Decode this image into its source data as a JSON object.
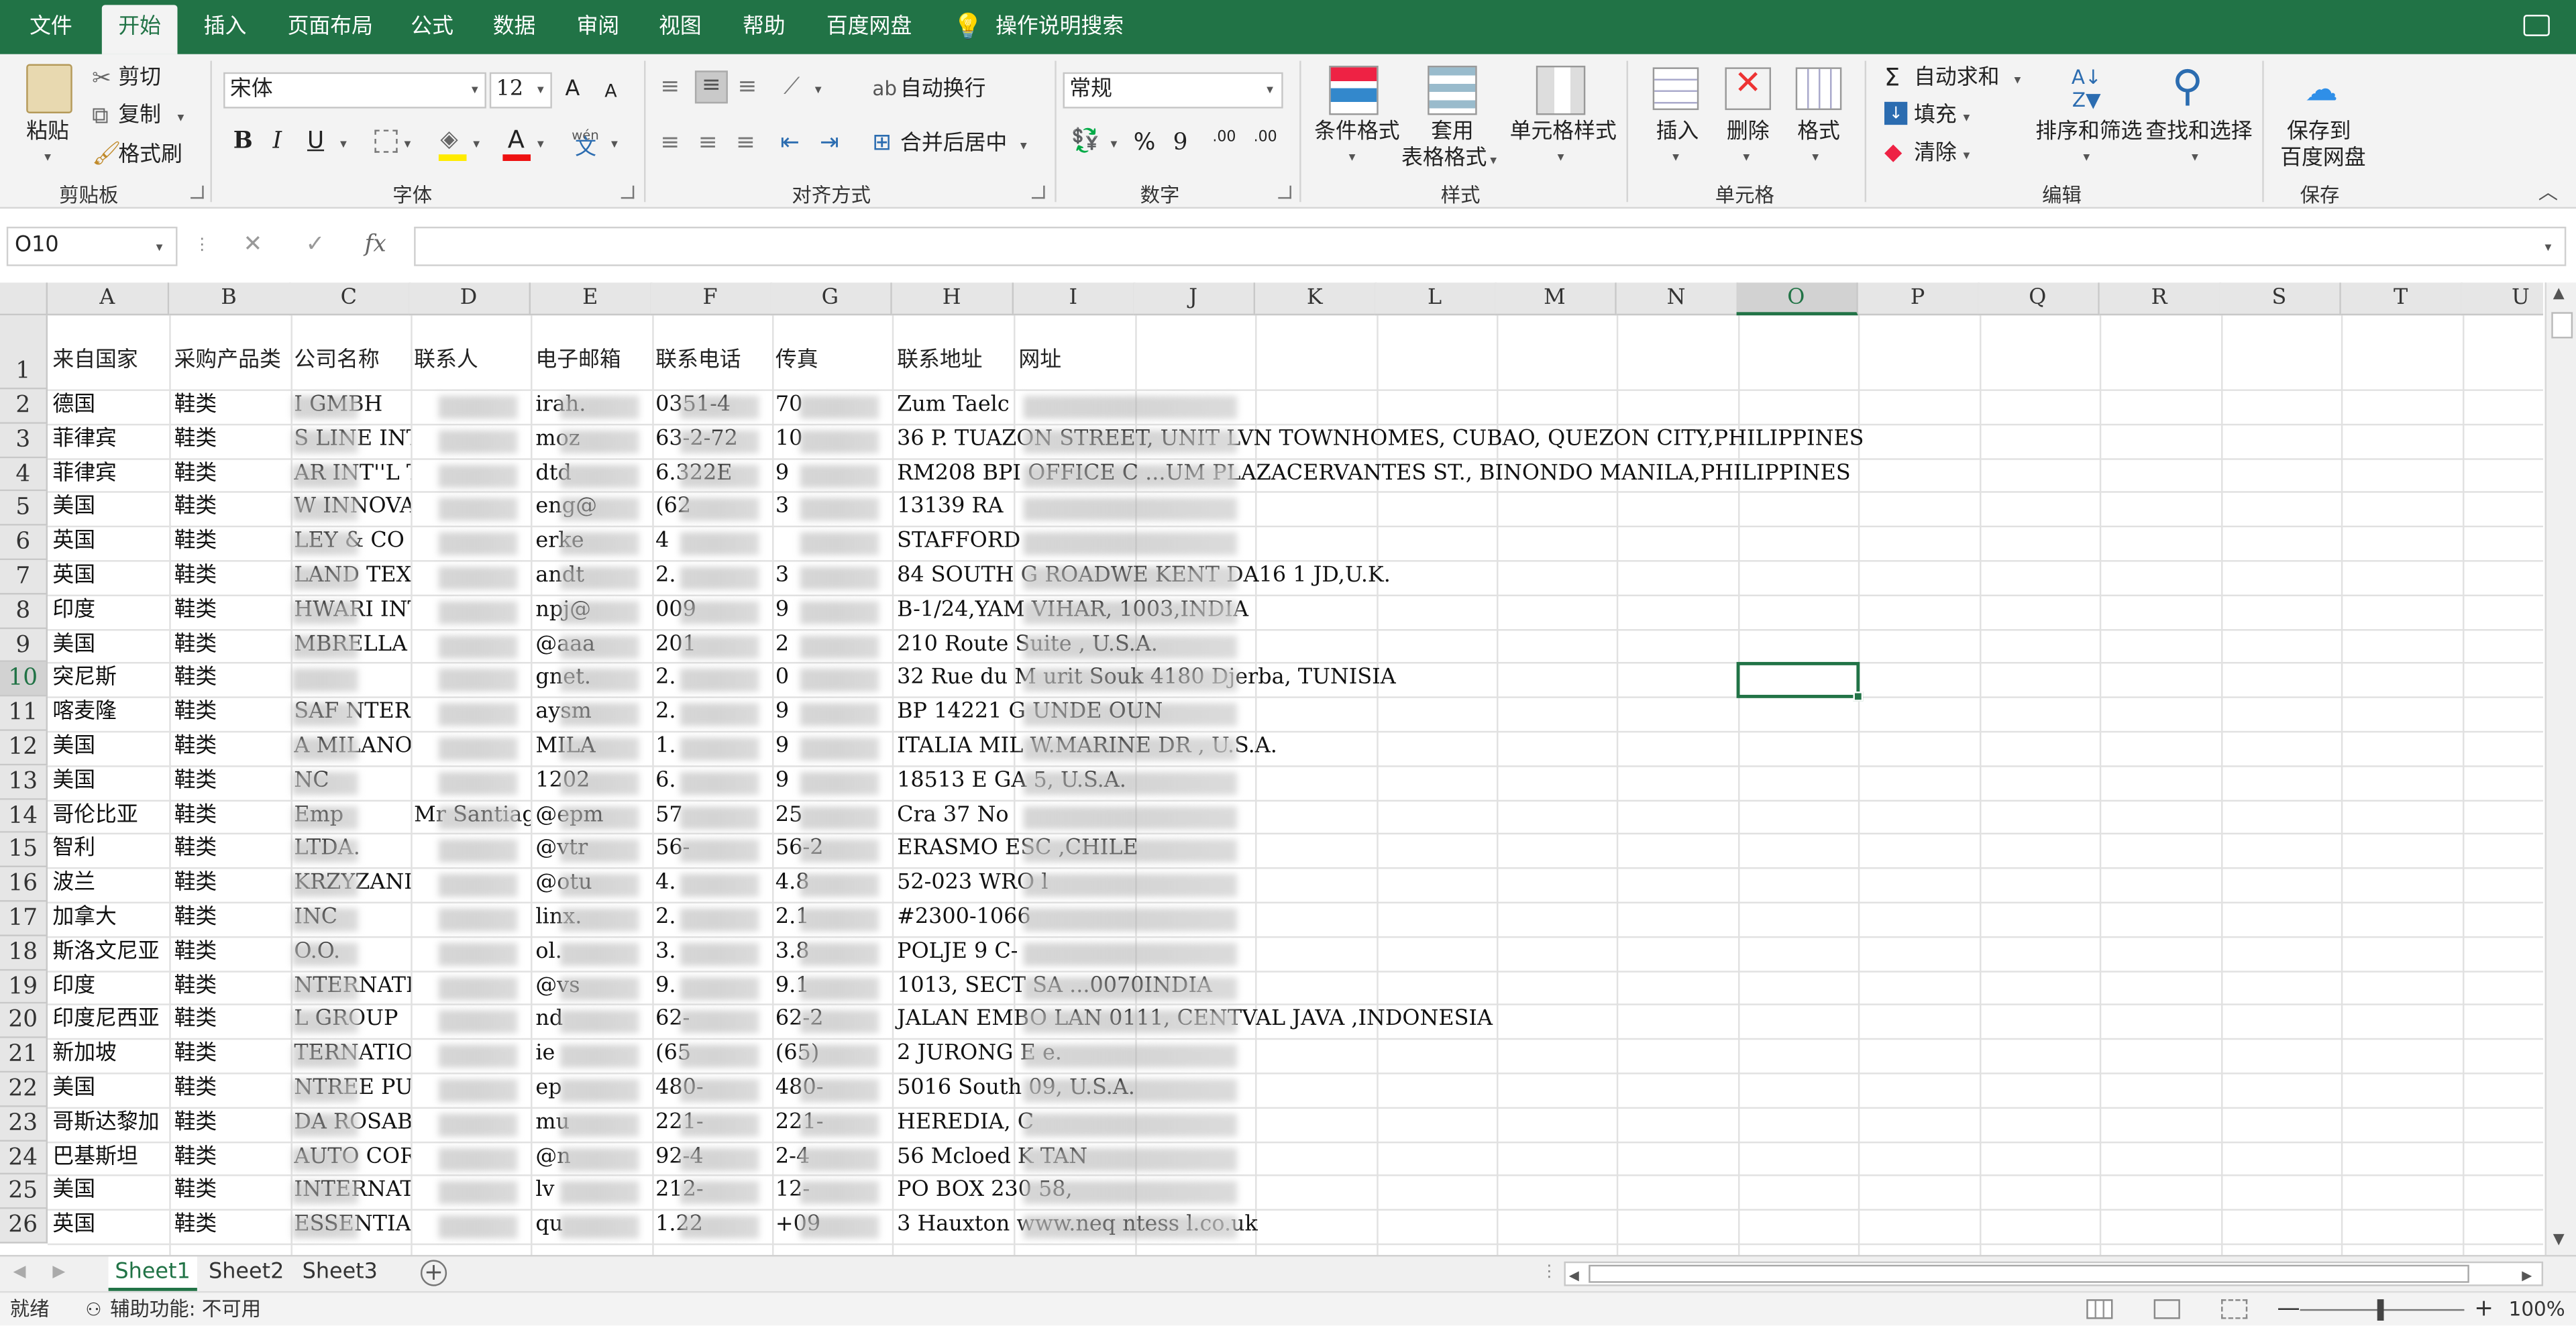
{
  "menu": {
    "file": "文件",
    "home": "开始",
    "insert": "插入",
    "page_layout": "页面布局",
    "formulas": "公式",
    "data": "数据",
    "review": "审阅",
    "view": "视图",
    "help": "帮助",
    "baidu": "百度网盘",
    "tell_me": "操作说明搜索"
  },
  "ribbon": {
    "clipboard": {
      "paste": "粘贴",
      "cut": "剪切",
      "copy": "复制",
      "format_painter": "格式刷",
      "label": "剪贴板"
    },
    "font": {
      "name": "宋体",
      "size": "12",
      "bold": "B",
      "italic": "I",
      "underline": "U",
      "phonetic": "wén",
      "phonetic_char": "文",
      "grow": "A",
      "shrink": "A",
      "font_color": "A",
      "label": "字体"
    },
    "alignment": {
      "wrap": "自动换行",
      "merge": "合并后居中",
      "label": "对齐方式"
    },
    "number": {
      "format": "常规",
      "percent": "%",
      "comma": "9",
      "inc_decimal": ".00",
      "dec_decimal": ".00",
      "label": "数字"
    },
    "styles": {
      "conditional": "条件格式",
      "table_line1": "套用",
      "table_line2": "表格格式",
      "cell_styles": "单元格样式",
      "label": "样式"
    },
    "cells": {
      "insert": "插入",
      "delete": "删除",
      "format": "格式",
      "label": "单元格"
    },
    "editing": {
      "autosum": "自动求和",
      "fill": "填充",
      "clear": "清除",
      "sort_filter": "排序和筛选",
      "find_select": "查找和选择",
      "label": "编辑"
    },
    "save": {
      "line1": "保存到",
      "line2": "百度网盘",
      "label": "保存"
    }
  },
  "formula_bar": {
    "name_box": "O10",
    "cancel": "✕",
    "enter": "✓",
    "fx": "fx",
    "value": ""
  },
  "columns": [
    "A",
    "B",
    "C",
    "D",
    "E",
    "F",
    "G",
    "H",
    "I",
    "J",
    "K",
    "L",
    "M",
    "N",
    "O",
    "P",
    "Q",
    "R",
    "S",
    "T",
    "U"
  ],
  "selected_column": "O",
  "selected_row": "10",
  "headers": {
    "A": "来自国家",
    "B": "采购产品类",
    "C": "公司名称",
    "D": "联系人",
    "E": "电子邮箱",
    "F": "联系电话",
    "G": "传真",
    "H": "联系地址",
    "I": "网址"
  },
  "rows": [
    {
      "n": "2",
      "a": "德国",
      "b": "鞋类",
      "c": "I GMBH",
      "d": "",
      "e": "irah.",
      "f": "0351-4",
      "g": "70",
      "h": "Zum Taelc"
    },
    {
      "n": "3",
      "a": "菲律宾",
      "b": "鞋类",
      "c": "S LINE INTERNATI",
      "d": "",
      "e": "moz",
      "f": "63-2-72",
      "g": "10",
      "h": "36 P. TUAZON STREET, UNIT LVN TOWNHOMES, CUBAO, QUEZON CITY,PHILIPPINES"
    },
    {
      "n": "4",
      "a": "菲律宾",
      "b": "鞋类",
      "c": "AR INT''L TRADIN",
      "d": "",
      "e": "dtd",
      "f": "6.322E",
      "g": "9",
      "h": "RM208 BPI OFFICE C ...UM PLAZACERVANTES ST., BINONDO MANILA,PHILIPPINES"
    },
    {
      "n": "5",
      "a": "美国",
      "b": "鞋类",
      "c": "W INNOVATIVE PRO",
      "d": "",
      "e": "eng@",
      "f": "(62",
      "g": "3",
      "h": "13139 RA"
    },
    {
      "n": "6",
      "a": "英国",
      "b": "鞋类",
      "c": "LEY & CO LIMITED",
      "d": "",
      "e": "erke",
      "f": "4",
      "g": "",
      "h": "STAFFORD"
    },
    {
      "n": "7",
      "a": "英国",
      "b": "鞋类",
      "c": "LAND TEXTILE",
      "d": "",
      "e": "andt",
      "f": "2.",
      "g": "3",
      "h": "84 SOUTH G ROADWE KENT DA16 1 JD,U.K."
    },
    {
      "n": "8",
      "a": "印度",
      "b": "鞋类",
      "c": "HWARI INTERNATIO",
      "d": "",
      "e": "npj@",
      "f": "009",
      "g": "9",
      "h": "B-1/24,YAM VIHAR, 1003,INDIA"
    },
    {
      "n": "9",
      "a": "美国",
      "b": "鞋类",
      "c": "MBRELLA COMPANY",
      "d": "",
      "e": "@aaa",
      "f": "201",
      "g": "2",
      "h": "210 Route Suite , U.S.A."
    },
    {
      "n": "10",
      "a": "突尼斯",
      "b": "鞋类",
      "c": "",
      "d": "",
      "e": "gnet.",
      "f": "2.",
      "g": "0",
      "h": "32 Rue du M urit Souk 4180 Djerba, TUNISIA"
    },
    {
      "n": "11",
      "a": "喀麦隆",
      "b": "鞋类",
      "c": "SAF NTERNATIONL",
      "d": "",
      "e": "aysm",
      "f": "2.",
      "g": "9",
      "h": "BP 14221 G UNDE OUN"
    },
    {
      "n": "12",
      "a": "美国",
      "b": "鞋类",
      "c": "A MILANO GUAM",
      "d": "",
      "e": "MILA",
      "f": "1.",
      "g": "9",
      "h": "ITALIA MIL W.MARINE DR , U.S.A."
    },
    {
      "n": "13",
      "a": "美国",
      "b": "鞋类",
      "c": "NC",
      "d": "",
      "e": "1202",
      "f": "6.",
      "g": "9",
      "h": "18513 E GA 5, U.S.A."
    },
    {
      "n": "14",
      "a": "哥伦比亚",
      "b": "鞋类",
      "c": "Emp",
      "d": "Mr Santiago",
      "e": "@epm",
      "f": "57",
      "g": "25",
      "h": "Cra 37 No"
    },
    {
      "n": "15",
      "a": "智利",
      "b": "鞋类",
      "c": "LTDA.",
      "d": "",
      "e": "@vtr",
      "f": "56-",
      "g": "56-2",
      "h": "ERASMO ESC ,CHILE"
    },
    {
      "n": "16",
      "a": "波兰",
      "b": "鞋类",
      "c": "KRZYZANIAK ROB",
      "d": "",
      "e": "@otu",
      "f": "4.",
      "g": "4.8",
      "h": "52-023 WRO l"
    },
    {
      "n": "17",
      "a": "加拿大",
      "b": "鞋类",
      "c": "INC",
      "d": "",
      "e": "linx.",
      "f": "2.",
      "g": "2.1",
      "h": "#2300-1066"
    },
    {
      "n": "18",
      "a": "斯洛文尼亚",
      "b": "鞋类",
      "c": "O.O.",
      "d": "",
      "e": "ol.",
      "f": "3.",
      "g": "3.8",
      "h": "POLJE 9 C-"
    },
    {
      "n": "19",
      "a": "印度",
      "b": "鞋类",
      "c": "NTERNATIONAL",
      "d": "",
      "e": "@vs",
      "f": "9.",
      "g": "9.1",
      "h": "1013, SECT SA ...0070INDIA"
    },
    {
      "n": "20",
      "a": "印度尼西亚",
      "b": "鞋类",
      "c": "L GROUP",
      "d": "",
      "e": "nd",
      "f": "62-",
      "g": "62-2",
      "h": "JALAN EMBO LAN 0111, CENTVAL JAVA ,INDONESIA"
    },
    {
      "n": "21",
      "a": "新加坡",
      "b": "鞋类",
      "c": "TERNATIONAL GROU",
      "d": "",
      "e": "ie",
      "f": "(65",
      "g": "(65)",
      "h": "2 JURONG E e."
    },
    {
      "n": "22",
      "a": "美国",
      "b": "鞋类",
      "c": "NTREE PUBLISHING",
      "d": "",
      "e": "ep",
      "f": "480-",
      "g": "480-",
      "h": "5016 South 09, U.S.A."
    },
    {
      "n": "23",
      "a": "哥斯达黎加",
      "b": "鞋类",
      "c": "DA ROSABAL",
      "d": "",
      "e": "mu",
      "f": "221-",
      "g": "221-",
      "h": "HEREDIA, C"
    },
    {
      "n": "24",
      "a": "巴基斯坦",
      "b": "鞋类",
      "c": "AUTO CORPORATIO",
      "d": "",
      "e": "@n",
      "f": "92-4",
      "g": "2-4",
      "h": "56 Mcloed K TAN"
    },
    {
      "n": "25",
      "a": "美国",
      "b": "鞋类",
      "c": "INTERNATIONAL INC",
      "d": "",
      "e": "lv",
      "f": "212-",
      "g": "12-",
      "h": "PO BOX 230 58,"
    },
    {
      "n": "26",
      "a": "英国",
      "b": "鞋类",
      "c": "ESSENTIAL (CAMB",
      "d": "",
      "e": "qu",
      "f": "1.22",
      "g": "+09",
      "h": "3 Hauxton www.neq ntess l.co.uk"
    }
  ],
  "sheets": [
    "Sheet1",
    "Sheet2",
    "Sheet3"
  ],
  "active_sheet": "Sheet1",
  "status": {
    "ready": "就绪",
    "accessibility": "辅助功能: 不可用",
    "zoom": "100%"
  },
  "colors": {
    "accent": "#217346"
  }
}
